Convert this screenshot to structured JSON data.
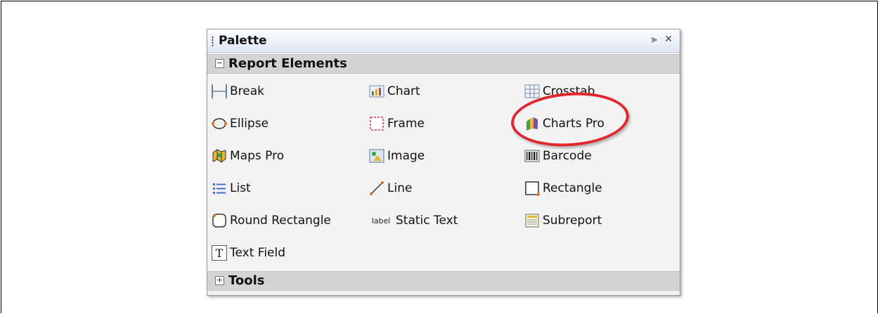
{
  "palette": {
    "title": "Palette",
    "sections": [
      {
        "label": "Report Elements",
        "expanded": true,
        "items": [
          {
            "label": "Break",
            "icon": "break-icon"
          },
          {
            "label": "Chart",
            "icon": "chart-icon"
          },
          {
            "label": "Crosstab",
            "icon": "crosstab-icon"
          },
          {
            "label": "Ellipse",
            "icon": "ellipse-icon"
          },
          {
            "label": "Frame",
            "icon": "frame-icon"
          },
          {
            "label": "Charts Pro",
            "icon": "charts-pro-icon"
          },
          {
            "label": "Maps Pro",
            "icon": "maps-pro-icon"
          },
          {
            "label": "Image",
            "icon": "image-icon"
          },
          {
            "label": "Barcode",
            "icon": "barcode-icon"
          },
          {
            "label": "List",
            "icon": "list-icon"
          },
          {
            "label": "Line",
            "icon": "line-icon"
          },
          {
            "label": "Rectangle",
            "icon": "rectangle-icon"
          },
          {
            "label": "Round Rectangle",
            "icon": "round-rectangle-icon"
          },
          {
            "label": "Static Text",
            "icon": "static-text-icon",
            "icon_text": "label"
          },
          {
            "label": "Subreport",
            "icon": "subreport-icon"
          },
          {
            "label": "Text Field",
            "icon": "text-field-icon",
            "icon_text": "T"
          }
        ]
      },
      {
        "label": "Tools",
        "expanded": false
      }
    ]
  },
  "colors": {
    "annotation": "#e1262c",
    "section_bg": "#d4d4d4",
    "titlebar": "#dfe7f3"
  }
}
